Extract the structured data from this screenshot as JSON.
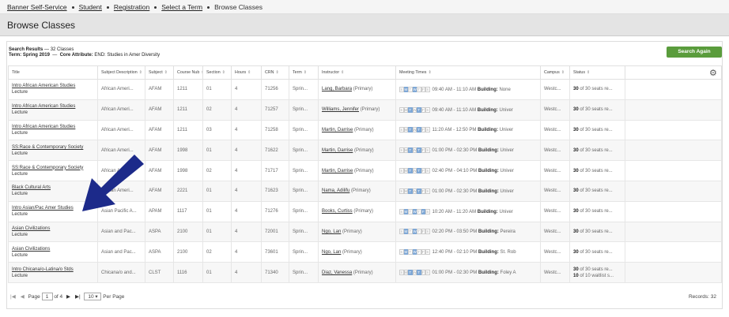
{
  "breadcrumb": [
    "Banner Self-Service",
    "Student",
    "Registration",
    "Select a Term"
  ],
  "breadcrumb_current": "Browse Classes",
  "page_title": "Browse Classes",
  "summary": {
    "heading": "Search Results",
    "count": "— 32 Classes",
    "term_label": "Term:",
    "term": "Spring 2019",
    "attr_label": "Core Attribute:",
    "attr": "END: Studies in Amer Diversity"
  },
  "search_again": "Search Again",
  "columns": [
    "Title",
    "Subject Description",
    "Subject",
    "Course Nub",
    "Section",
    "Hours",
    "CRN",
    "Term",
    "Instructor",
    "Meeting Times",
    "Campus",
    "Status"
  ],
  "day_letters": [
    "S",
    "M",
    "T",
    "W",
    "T",
    "F",
    "S"
  ],
  "building_label": "Building:",
  "rows": [
    {
      "title": "Intro African American Studies",
      "type": "Lecture",
      "subj_desc": "African Ameri...",
      "subj": "AFAM",
      "course": "1211",
      "section": "01",
      "hours": "4",
      "crn": "71256",
      "term": "Sprin...",
      "instructor": "Lang, Barbara",
      "role": "(Primary)",
      "days": [
        0,
        1,
        0,
        1,
        0,
        0,
        0
      ],
      "time": "09:40 AM - 11:10 AM",
      "building": "None",
      "campus": "Westc...",
      "status": "30",
      "status_rest": "of 30 seats re..."
    },
    {
      "title": "Intro African American Studies",
      "type": "Lecture",
      "subj_desc": "African Ameri...",
      "subj": "AFAM",
      "course": "1211",
      "section": "02",
      "hours": "4",
      "crn": "71257",
      "term": "Sprin...",
      "instructor": "Williams, Jennifer",
      "role": "(Primary)",
      "days": [
        0,
        0,
        1,
        0,
        1,
        0,
        0
      ],
      "time": "09:40 AM - 11:10 AM",
      "building": "Univer",
      "campus": "Westc...",
      "status": "30",
      "status_rest": "of 30 seats re..."
    },
    {
      "title": "Intro African American Studies",
      "type": "Lecture",
      "subj_desc": "African Ameri...",
      "subj": "AFAM",
      "course": "1211",
      "section": "03",
      "hours": "4",
      "crn": "71258",
      "term": "Sprin...",
      "instructor": "Martin, Darrise",
      "role": "(Primary)",
      "days": [
        0,
        0,
        1,
        0,
        1,
        0,
        0
      ],
      "time": "11:20 AM - 12:50 PM",
      "building": "Univer",
      "campus": "Westc...",
      "status": "30",
      "status_rest": "of 30 seats re..."
    },
    {
      "title": "SS:Race & Contemporary Society",
      "type": "Lecture",
      "subj_desc": "African Ameri...",
      "subj": "AFAM",
      "course": "1998",
      "section": "01",
      "hours": "4",
      "crn": "71622",
      "term": "Sprin...",
      "instructor": "Martin, Darrise",
      "role": "(Primary)",
      "days": [
        0,
        0,
        1,
        0,
        1,
        0,
        0
      ],
      "time": "01:00 PM - 02:30 PM",
      "building": "Univer",
      "campus": "Westc...",
      "status": "30",
      "status_rest": "of 30 seats re..."
    },
    {
      "title": "SS:Race & Contemporary Society",
      "type": "Lecture",
      "subj_desc": "African Ameri...",
      "subj": "AFAM",
      "course": "1998",
      "section": "02",
      "hours": "4",
      "crn": "71717",
      "term": "Sprin...",
      "instructor": "Martin, Darrise",
      "role": "(Primary)",
      "days": [
        0,
        0,
        1,
        0,
        1,
        0,
        0
      ],
      "time": "02:40 PM - 04:10 PM",
      "building": "Univer",
      "campus": "Westc...",
      "status": "30",
      "status_rest": "of 30 seats re..."
    },
    {
      "title": "Black Cultural Arts",
      "type": "Lecture",
      "subj_desc": "African Ameri...",
      "subj": "AFAM",
      "course": "2221",
      "section": "01",
      "hours": "4",
      "crn": "71623",
      "term": "Sprin...",
      "instructor": "Nama, Adilifu",
      "role": "(Primary)",
      "days": [
        0,
        0,
        1,
        0,
        1,
        0,
        0
      ],
      "time": "01:00 PM - 02:30 PM",
      "building": "Univer",
      "campus": "Westc...",
      "status": "30",
      "status_rest": "of 30 seats re..."
    },
    {
      "title": "Intro Asian/Pac Amer Studies",
      "type": "Lecture",
      "subj_desc": "Asian Pacific A...",
      "subj": "APAM",
      "course": "1117",
      "section": "01",
      "hours": "4",
      "crn": "71276",
      "term": "Sprin...",
      "instructor": "Books, Curtiss",
      "role": "(Primary)",
      "days": [
        0,
        1,
        0,
        1,
        0,
        1,
        0
      ],
      "time": "10:20 AM - 11:20 AM",
      "building": "Univer",
      "campus": "Westc...",
      "status": "30",
      "status_rest": "of 30 seats re..."
    },
    {
      "title": "Asian Civilizations",
      "type": "Lecture",
      "subj_desc": "Asian and Pac...",
      "subj": "ASPA",
      "course": "2100",
      "section": "01",
      "hours": "4",
      "crn": "72001",
      "term": "Sprin...",
      "instructor": "Ngo, Lan",
      "role": "(Primary)",
      "days": [
        0,
        1,
        0,
        1,
        0,
        0,
        0
      ],
      "time": "02:20 PM - 03:50 PM",
      "building": "Pereira",
      "campus": "Westc...",
      "status": "30",
      "status_rest": "of 30 seats re..."
    },
    {
      "title": "Asian Civilizations",
      "type": "Lecture",
      "subj_desc": "Asian and Pac...",
      "subj": "ASPA",
      "course": "2100",
      "section": "02",
      "hours": "4",
      "crn": "73601",
      "term": "Sprin...",
      "instructor": "Ngo, Lan",
      "role": "(Primary)",
      "days": [
        0,
        1,
        0,
        1,
        0,
        0,
        0
      ],
      "time": "12:40 PM - 02:10 PM",
      "building": "St. Rob",
      "campus": "Westc...",
      "status": "30",
      "status_rest": "of 30 seats re..."
    },
    {
      "title": "Intro Chicana/o-Latina/o Stds",
      "type": "Lecture",
      "subj_desc": "Chicana/o and...",
      "subj": "CLST",
      "course": "1116",
      "section": "01",
      "hours": "4",
      "crn": "71340",
      "term": "Sprin...",
      "instructor": "Diaz, Vanessa",
      "role": "(Primary)",
      "days": [
        0,
        0,
        1,
        0,
        1,
        0,
        0
      ],
      "time": "01:00 PM - 02:30 PM",
      "building": "Foley A",
      "campus": "Westc...",
      "status": "30",
      "status_rest": "of 30 seats re...",
      "status2": "10",
      "status2_rest": "of 10 waitlist s..."
    }
  ],
  "pager": {
    "page_label": "Page",
    "page": "1",
    "of": "of",
    "total_pages": "4",
    "per_page": "10",
    "per_page_label": "Per Page",
    "records": "Records: 32"
  },
  "colors": {
    "accent": "#5a9c3c",
    "day_on": "#7fa8d6",
    "arrow": "#1c2a8a"
  }
}
